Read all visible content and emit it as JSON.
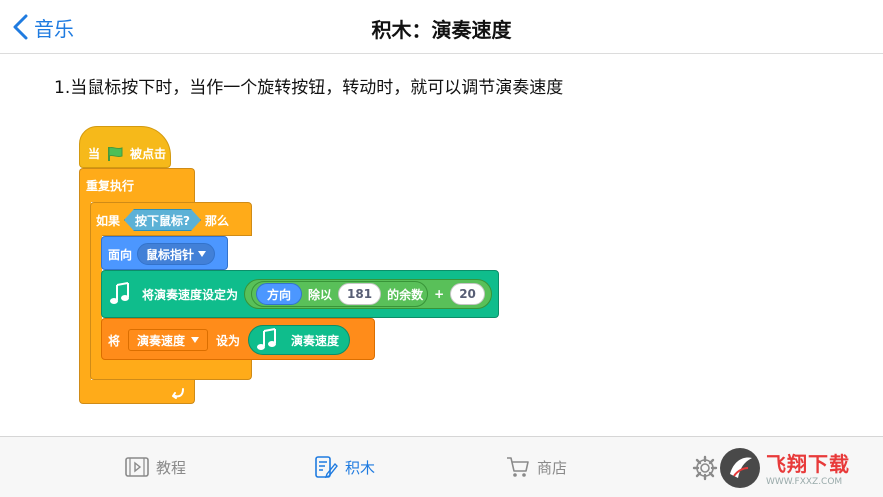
{
  "header": {
    "back_label": "音乐",
    "title": "积木：演奏速度"
  },
  "instruction": "1.当鼠标按下时，当作一个旋转按钮，转动时，就可以调节演奏速度",
  "blocks": {
    "hat_when": "当",
    "hat_clicked": "被点击",
    "forever": "重复执行",
    "if_label": "如果",
    "if_condition": "按下鼠标?",
    "if_then": "那么",
    "point_towards": "面向",
    "point_target": "鼠标指针",
    "set_tempo": "将演奏速度设定为",
    "direction": "方向",
    "mod_label": "除以",
    "mod_value": "181",
    "remainder": "的余数",
    "plus": "+",
    "add_value": "20",
    "set_var_prefix": "将",
    "var_name": "演奏速度",
    "set_to": "设为",
    "tempo_reporter": "演奏速度"
  },
  "tabs": {
    "tutorial": "教程",
    "blocks": "积木",
    "store": "商店"
  },
  "watermark": {
    "main": "飞翔下载",
    "sub": "WWW.FXXZ.COM"
  },
  "colors": {
    "accent": "#1f7be0",
    "events": "#ffbf00",
    "control": "#ffab19",
    "motion": "#4c97ff",
    "music": "#0fbd8c",
    "operators": "#59c059",
    "variables": "#ff8c1a"
  }
}
